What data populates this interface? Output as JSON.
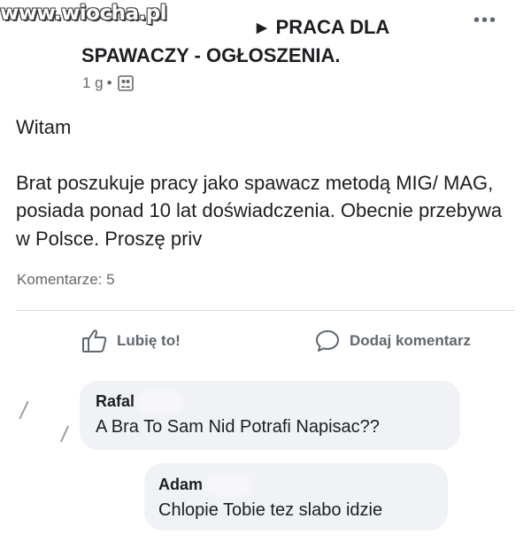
{
  "watermark": "www.wiocha.pl",
  "group": {
    "title_line1": "PRACA DLA",
    "title_line2": "SPAWACZY - OGŁOSZENIA."
  },
  "post": {
    "time": "1 g",
    "separator": "•",
    "greeting": "Witam",
    "body": "Brat poszukuje pracy jako spawacz metodą MIG/ MAG, posiada ponad 10 lat doświadczenia. Obecnie przebywa w Polsce. Proszę priv",
    "comments_count": "Komentarze: 5"
  },
  "actions": {
    "like_label": "Lubię to!",
    "comment_label": "Dodaj komentarz"
  },
  "comments": [
    {
      "author": "Rafal",
      "text": "A Bra To Sam Nid Potrafi Napisac??"
    },
    {
      "author": "Adam",
      "text": "Chlopie Tobie tez slabo idzie"
    }
  ],
  "icons": {
    "more": "more-options-icon",
    "privacy": "group-members-icon",
    "like": "thumbs-up-icon",
    "comment": "comment-bubble-icon"
  }
}
